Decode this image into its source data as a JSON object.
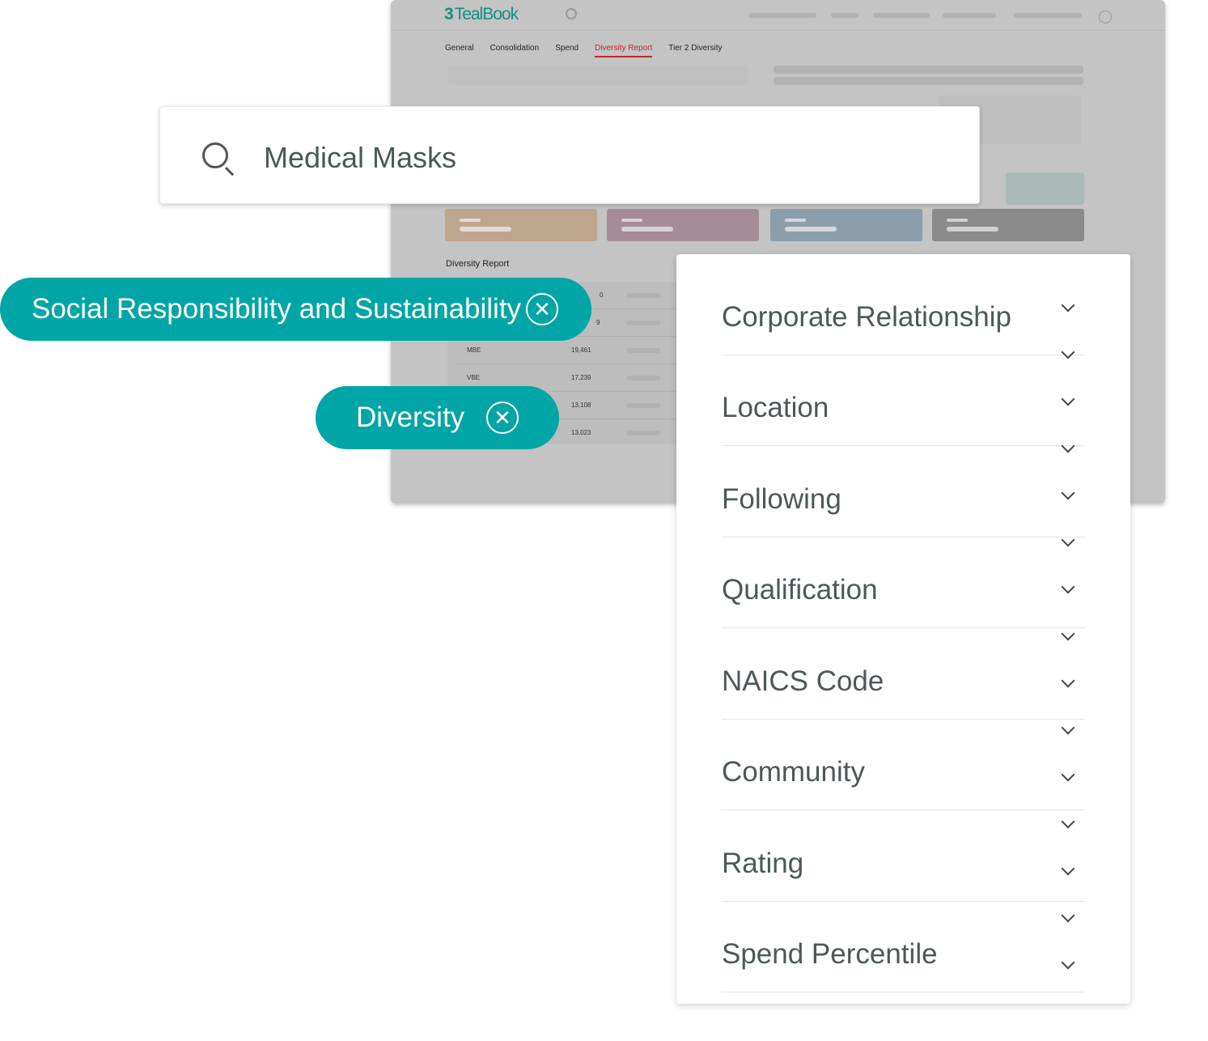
{
  "app": {
    "logo": "TealBook",
    "brand_color": "#138f80"
  },
  "tabs": [
    {
      "label": "General"
    },
    {
      "label": "Consolidation"
    },
    {
      "label": "Spend"
    },
    {
      "label": "Diversity Report",
      "active": true
    },
    {
      "label": "Tier 2 Diversity"
    }
  ],
  "section_title": "Diversity Report",
  "table_rows": [
    {
      "key": "",
      "value": "0"
    },
    {
      "key": "",
      "value": "9"
    },
    {
      "key": "MBE",
      "value": "19,461"
    },
    {
      "key": "VBE",
      "value": "17,239"
    },
    {
      "key": "",
      "value": "13,108"
    },
    {
      "key": "",
      "value": "13,023"
    }
  ],
  "search": {
    "value": "Medical Masks",
    "icon": "search-icon"
  },
  "chips": [
    {
      "label": "Social Responsibility and Sustainability",
      "icon": "close-circle-icon"
    },
    {
      "label": "Diversity",
      "icon": "close-circle-icon"
    }
  ],
  "chip_color": "#00a5a5",
  "filters": [
    {
      "label": "Corporate Relationship"
    },
    {
      "label": "Location"
    },
    {
      "label": "Following"
    },
    {
      "label": "Qualification"
    },
    {
      "label": "NAICS Code"
    },
    {
      "label": "Community"
    },
    {
      "label": "Rating"
    },
    {
      "label": "Spend Percentile"
    }
  ]
}
